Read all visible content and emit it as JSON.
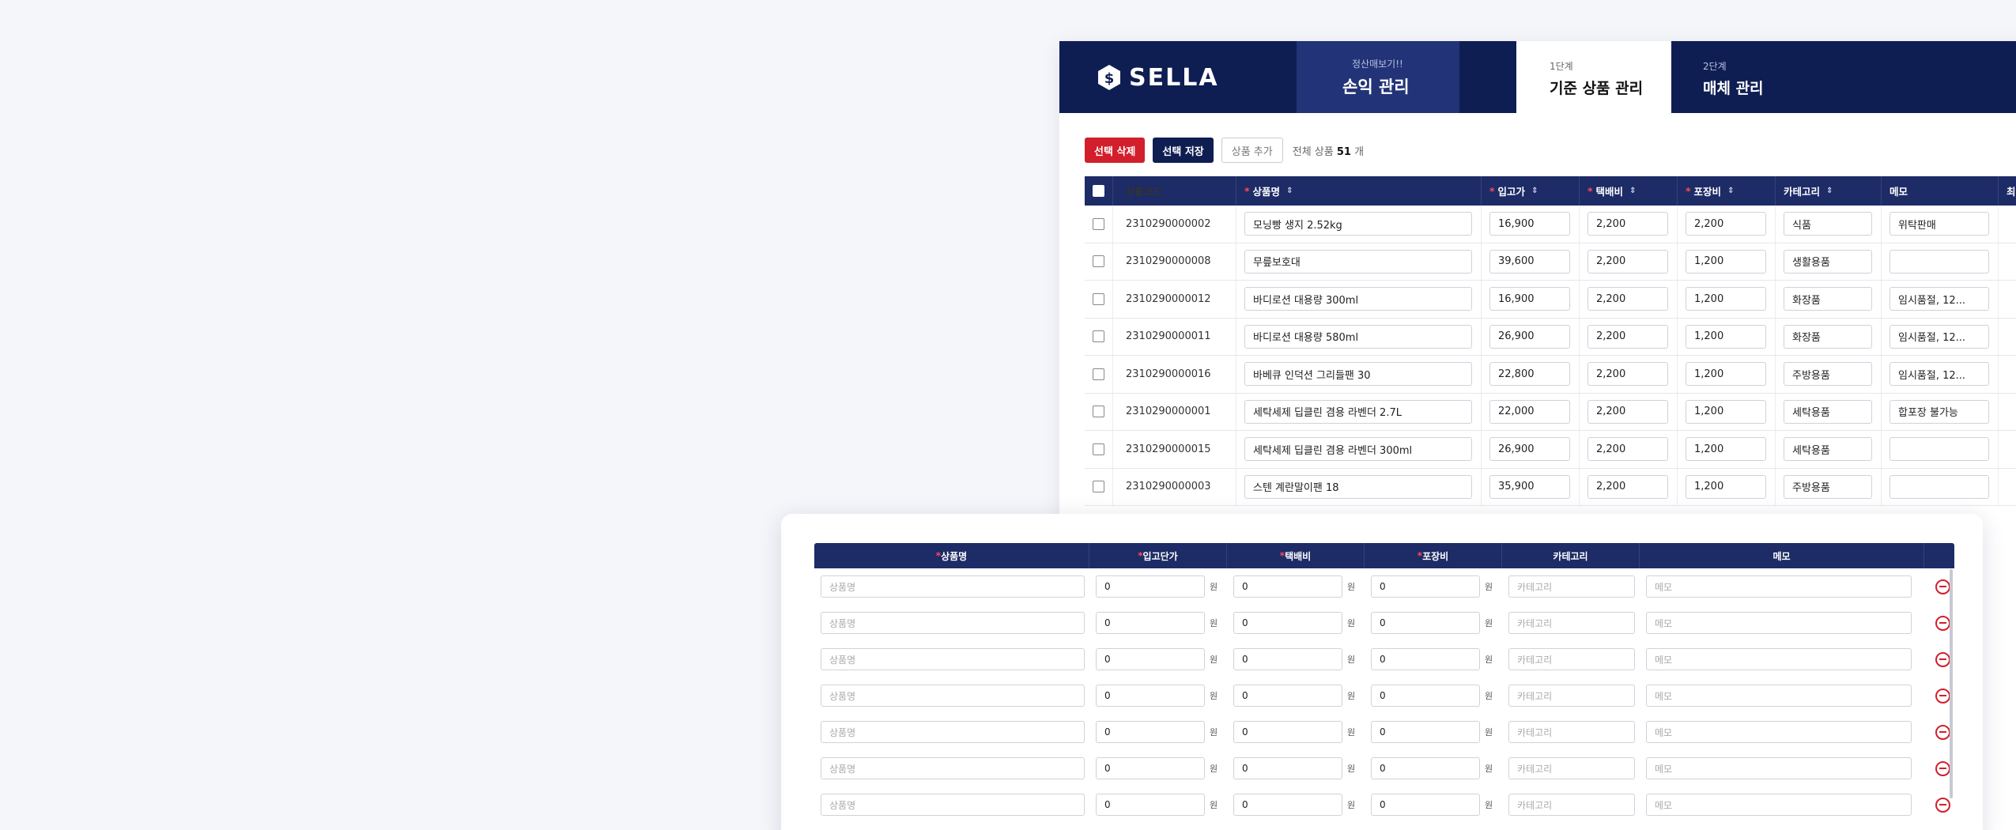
{
  "app": {
    "logo_text": "SELLA"
  },
  "tabs": {
    "profit": {
      "sub": "정산매보기!!",
      "label": "손익 관리"
    },
    "base": {
      "sub": "1단계",
      "label": "기준 상품 관리"
    },
    "media": {
      "sub": "2단계",
      "label": "매체 관리"
    }
  },
  "toolbar": {
    "delete_label": "선택 삭제",
    "save_label": "선택 저장",
    "add_label": "상품 추가",
    "total_prefix": "전체 상품",
    "total_count": "51",
    "total_suffix": "개"
  },
  "grid": {
    "columns": {
      "code": "상품코드",
      "name": "상품명",
      "cost": "입고가",
      "ship": "택배비",
      "pack": "포장비",
      "category": "카테고리",
      "memo": "메모",
      "last": "최"
    },
    "rows": [
      {
        "code": "2310290000002",
        "name": "모닝빵 생지 2.52kg",
        "cost": "16,900",
        "ship": "2,200",
        "pack": "2,200",
        "category": "식품",
        "memo": "위탁판매"
      },
      {
        "code": "2310290000008",
        "name": "무릎보호대",
        "cost": "39,600",
        "ship": "2,200",
        "pack": "1,200",
        "category": "생활용품",
        "memo": ""
      },
      {
        "code": "2310290000012",
        "name": "바디로션 대용량 300ml",
        "cost": "16,900",
        "ship": "2,200",
        "pack": "1,200",
        "category": "화장품",
        "memo": "임시품절, 12..."
      },
      {
        "code": "2310290000011",
        "name": "바디로션 대용량 580ml",
        "cost": "26,900",
        "ship": "2,200",
        "pack": "1,200",
        "category": "화장품",
        "memo": "임시품절, 12..."
      },
      {
        "code": "2310290000016",
        "name": "바베큐 인덕션 그리들팬 30",
        "cost": "22,800",
        "ship": "2,200",
        "pack": "1,200",
        "category": "주방용품",
        "memo": "임시품절, 12..."
      },
      {
        "code": "2310290000001",
        "name": "세탁세제 딥클린 겸용 라벤더 2.7L",
        "cost": "22,000",
        "ship": "2,200",
        "pack": "1,200",
        "category": "세탁용품",
        "memo": "합포장 불가능"
      },
      {
        "code": "2310290000015",
        "name": "세탁세제 딥클린 겸용 라벤더 300ml",
        "cost": "26,900",
        "ship": "2,200",
        "pack": "1,200",
        "category": "세탁용품",
        "memo": ""
      },
      {
        "code": "2310290000003",
        "name": "스텐 계란말이팬 18",
        "cost": "35,900",
        "ship": "2,200",
        "pack": "1,200",
        "category": "주방용품",
        "memo": ""
      }
    ]
  },
  "modal": {
    "columns": {
      "name": "상품명",
      "cost": "입고단가",
      "ship": "택배비",
      "pack": "포장비",
      "category": "카테고리",
      "memo": "메모"
    },
    "placeholders": {
      "name": "상품명",
      "category": "카테고리",
      "memo": "메모"
    },
    "default_value": "0",
    "unit": "원",
    "row_count": 7
  },
  "colors": {
    "navy": "#0f1e52",
    "header": "#1d2b66",
    "danger": "#d21f2b"
  }
}
